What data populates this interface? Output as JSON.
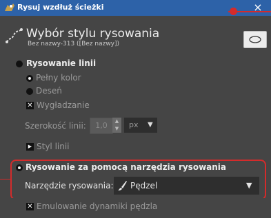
{
  "window": {
    "title": "Rysuj wzdłuż ścieżki",
    "close_glyph": "×",
    "app_icon": "gimp-icon"
  },
  "header": {
    "heading": "Wybór stylu rysowania",
    "subtitle": "Bez nazwy-313 ([Bez nazwy])",
    "icon": "stroke-path-icon",
    "preview_icon": "lasso-path-icon"
  },
  "line_section": {
    "label": "Rysowanie linii",
    "selected": false,
    "options": [
      {
        "label": "Pełny kolor",
        "selected": true
      },
      {
        "label": "Deseń",
        "selected": false
      }
    ],
    "antialias": {
      "label": "Wygładzanie",
      "checked": true
    },
    "width": {
      "label": "Szerokość linii:",
      "value": "1,0",
      "unit": "px"
    },
    "line_style": {
      "label": "Styl linii",
      "expander": "collapsed"
    }
  },
  "tool_section": {
    "label": "Rysowanie za pomocą narzędzia rysowania",
    "selected": true,
    "tool_label": "Narzędzie rysowania:",
    "tool_value": "Pędzel",
    "tool_icon": "paintbrush-icon",
    "emulate": {
      "label": "Emulowanie dynamiki pędzla",
      "checked": true
    }
  },
  "colors": {
    "titlebar": "#2d62a8",
    "panel": "#454545",
    "annotation": "#d42b2b"
  }
}
